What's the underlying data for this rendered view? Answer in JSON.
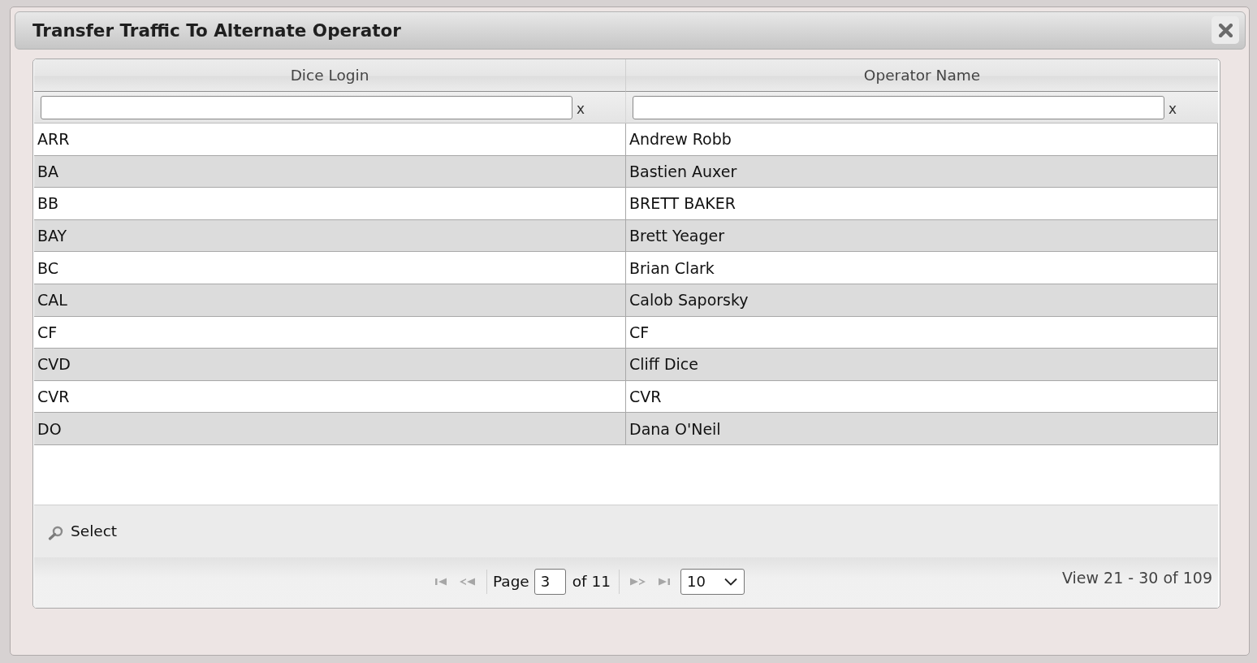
{
  "window": {
    "title": "Transfer Traffic To Alternate Operator"
  },
  "table": {
    "columns": [
      {
        "label": "Dice Login",
        "filter_clear": "x"
      },
      {
        "label": "Operator Name",
        "filter_clear": "x"
      }
    ],
    "rows": [
      {
        "cells": [
          "ARR",
          "Andrew Robb"
        ]
      },
      {
        "cells": [
          "BA",
          "Bastien Auxer"
        ]
      },
      {
        "cells": [
          "BB",
          "BRETT BAKER"
        ]
      },
      {
        "cells": [
          "BAY",
          "Brett Yeager"
        ]
      },
      {
        "cells": [
          "BC",
          "Brian Clark"
        ]
      },
      {
        "cells": [
          "CAL",
          "Calob Saporsky"
        ]
      },
      {
        "cells": [
          "CF",
          "CF"
        ]
      },
      {
        "cells": [
          "CVD",
          "Cliff Dice"
        ]
      },
      {
        "cells": [
          "CVR",
          "CVR"
        ]
      },
      {
        "cells": [
          "DO",
          "Dana O'Neil"
        ]
      }
    ]
  },
  "toolbar": {
    "buttons": [
      {
        "label": "Select"
      }
    ]
  },
  "pager": {
    "page_label": "Page",
    "page": "3",
    "of_label": "of 11",
    "page_size": "10",
    "summary": "View 21 - 30 of 109"
  }
}
